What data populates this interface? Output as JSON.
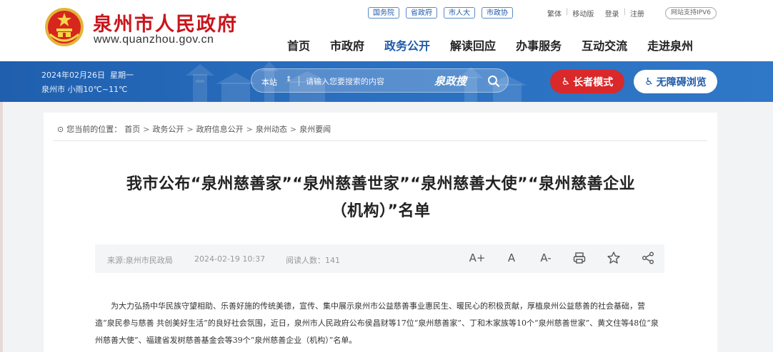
{
  "header": {
    "site_title": "泉州市人民政府",
    "site_url": "www.quanzhou.gov.cn",
    "top_links": [
      "国务院",
      "省政府",
      "市人大",
      "市政协"
    ],
    "util_links": [
      "繁体",
      "移动版",
      "登录",
      "注册"
    ],
    "ipv6_badge": "网站支持IPV6",
    "nav": [
      "首页",
      "市政府",
      "政务公开",
      "解读回应",
      "办事服务",
      "互动交流",
      "走进泉州"
    ],
    "active_nav": "政务公开"
  },
  "banner": {
    "date": "2024年02月26日",
    "weekday": "星期一",
    "weather": "泉州市 小雨10℃~11℃",
    "search": {
      "scope": "本站",
      "placeholder": "请输入您要搜索的内容",
      "brand": "泉政搜"
    },
    "elder_mode_label": "长者模式",
    "accessibility_label": "无障碍浏览"
  },
  "breadcrumb": {
    "prefix": "您当前的位置：",
    "items": [
      "首页",
      "政务公开",
      "政府信息公开",
      "泉州动态",
      "泉州要闻"
    ]
  },
  "article": {
    "title_line1": "我市公布“泉州慈善家”“泉州慈善世家”“泉州慈善大使”“泉州慈善企业",
    "title_line2": "（机构）”名单",
    "source": "来源:泉州市民政局",
    "date": "2024-02-19 10:37",
    "reads_label": "阅读人数：",
    "reads": "141",
    "tools": [
      "A+",
      "A",
      "A-"
    ],
    "body": "为大力弘扬中华民族守望相助、乐善好施的传统美德，宣传、集中展示泉州市公益慈善事业惠民生、暖民心的积极贡献，厚植泉州公益慈善的社会基础，营造“泉民参与慈善 共创美好生活”的良好社会氛围，近日，泉州市人民政府公布侯昌财等17位“泉州慈善家”、丁和木家族等10个“泉州慈善世家”、黄文住等48位“泉州慈善大使”、福建省发树慈善基金会等39个“泉州慈善企业（机构）”名单。"
  },
  "colors": {
    "brand_red": "#c8161d",
    "nav_blue": "#1d59a9",
    "banner_blue": "#2a6fc0",
    "elder_red": "#d9292a"
  }
}
